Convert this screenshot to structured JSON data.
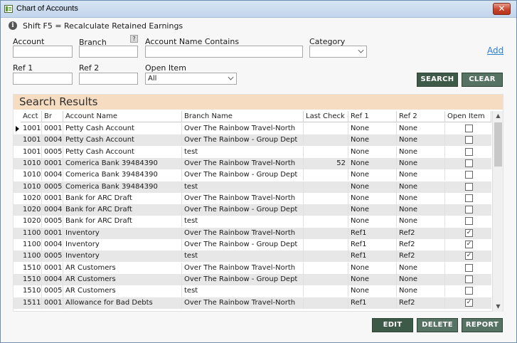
{
  "window": {
    "title": "Chart of Accounts",
    "close_glyph": "✕"
  },
  "info": {
    "icon": "info-icon",
    "text": "Shift F5 = Recalculate Retained Earnings"
  },
  "filters": {
    "account": {
      "label": "Account",
      "value": ""
    },
    "branch": {
      "label": "Branch",
      "value": "",
      "help_glyph": "?"
    },
    "account_name_contains": {
      "label": "Account Name Contains",
      "value": ""
    },
    "category": {
      "label": "Category",
      "value": ""
    },
    "ref1": {
      "label": "Ref 1",
      "value": ""
    },
    "ref2": {
      "label": "Ref 2",
      "value": ""
    },
    "open_item": {
      "label": "Open Item",
      "value": "All"
    }
  },
  "add_link": "Add",
  "buttons": {
    "search": "SEARCH",
    "clear": "CLEAR",
    "edit": "EDIT",
    "delete": "DELETE",
    "report": "REPORT"
  },
  "results": {
    "title": "Search Results",
    "columns": [
      "Acct",
      "Br",
      "Account Name",
      "Branch Name",
      "Last Check #",
      "Ref 1",
      "Ref 2",
      "Open Item"
    ],
    "rows": [
      {
        "acct": "1001",
        "br": "0001",
        "name": "Petty Cash Account",
        "branch": "Over The Rainbow Travel-North",
        "last_check": "",
        "ref1": "None",
        "ref2": "None",
        "open_item": false,
        "current": true
      },
      {
        "acct": "1001",
        "br": "0004",
        "name": "Petty Cash Account",
        "branch": "Over The Rainbow - Group Dept",
        "last_check": "",
        "ref1": "None",
        "ref2": "None",
        "open_item": false
      },
      {
        "acct": "1001",
        "br": "0005",
        "name": "Petty Cash Account",
        "branch": "test",
        "last_check": "",
        "ref1": "None",
        "ref2": "None",
        "open_item": false
      },
      {
        "acct": "1010",
        "br": "0001",
        "name": "Comerica Bank 39484390",
        "branch": "Over The Rainbow Travel-North",
        "last_check": "52",
        "ref1": "None",
        "ref2": "None",
        "open_item": false
      },
      {
        "acct": "1010",
        "br": "0004",
        "name": "Comerica Bank 39484390",
        "branch": "Over The Rainbow - Group Dept",
        "last_check": "",
        "ref1": "None",
        "ref2": "None",
        "open_item": false
      },
      {
        "acct": "1010",
        "br": "0005",
        "name": "Comerica Bank 39484390",
        "branch": "test",
        "last_check": "",
        "ref1": "None",
        "ref2": "None",
        "open_item": false
      },
      {
        "acct": "1020",
        "br": "0001",
        "name": "Bank for ARC Draft",
        "branch": "Over The Rainbow Travel-North",
        "last_check": "",
        "ref1": "None",
        "ref2": "None",
        "open_item": false
      },
      {
        "acct": "1020",
        "br": "0004",
        "name": "Bank for ARC Draft",
        "branch": "Over The Rainbow - Group Dept",
        "last_check": "",
        "ref1": "None",
        "ref2": "None",
        "open_item": false
      },
      {
        "acct": "1020",
        "br": "0005",
        "name": "Bank for ARC Draft",
        "branch": "test",
        "last_check": "",
        "ref1": "None",
        "ref2": "None",
        "open_item": false
      },
      {
        "acct": "1100",
        "br": "0001",
        "name": "Inventory",
        "branch": "Over The Rainbow Travel-North",
        "last_check": "",
        "ref1": "Ref1",
        "ref2": "Ref2",
        "open_item": true
      },
      {
        "acct": "1100",
        "br": "0004",
        "name": "Inventory",
        "branch": "Over The Rainbow - Group Dept",
        "last_check": "",
        "ref1": "Ref1",
        "ref2": "Ref2",
        "open_item": true
      },
      {
        "acct": "1100",
        "br": "0005",
        "name": "Inventory",
        "branch": "test",
        "last_check": "",
        "ref1": "Ref1",
        "ref2": "Ref2",
        "open_item": true
      },
      {
        "acct": "1510",
        "br": "0001",
        "name": "AR Customers",
        "branch": "Over The Rainbow Travel-North",
        "last_check": "",
        "ref1": "None",
        "ref2": "None",
        "open_item": false
      },
      {
        "acct": "1510",
        "br": "0004",
        "name": "AR Customers",
        "branch": "Over The Rainbow - Group Dept",
        "last_check": "",
        "ref1": "None",
        "ref2": "None",
        "open_item": false
      },
      {
        "acct": "1510",
        "br": "0005",
        "name": "AR Customers",
        "branch": "test",
        "last_check": "",
        "ref1": "None",
        "ref2": "None",
        "open_item": false
      },
      {
        "acct": "1511",
        "br": "0001",
        "name": "Allowance for Bad Debts",
        "branch": "Over The Rainbow Travel-North",
        "last_check": "",
        "ref1": "Ref1",
        "ref2": "Ref2",
        "open_item": true
      }
    ]
  },
  "check_glyph": "✓",
  "scroll_up_glyph": "▲",
  "scroll_down_glyph": "▼",
  "colors": {
    "button_dark": "#3d5948",
    "results_header": "#f6dcc1",
    "alt_row": "#e7e7e7",
    "link": "#2a7fd4"
  }
}
